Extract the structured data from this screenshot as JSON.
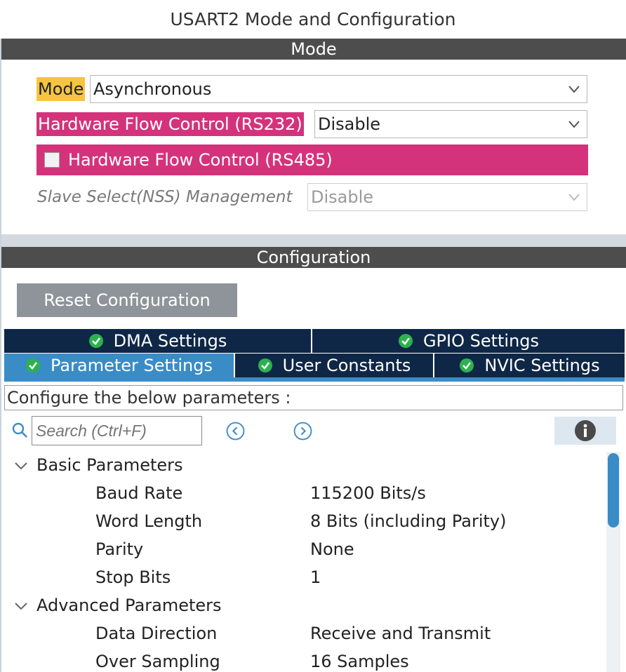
{
  "window": {
    "title": "USART2 Mode and Configuration"
  },
  "mode_section": {
    "header": "Mode",
    "mode": {
      "label": "Mode",
      "value": "Asynchronous"
    },
    "hw_flow_rs232": {
      "label": "Hardware Flow Control (RS232)",
      "value": "Disable"
    },
    "hw_flow_rs485": {
      "label": "Hardware Flow Control (RS485)",
      "checked": false
    },
    "slave_select": {
      "label": "Slave Select(NSS) Management",
      "value": "Disable",
      "disabled": true
    }
  },
  "config_section": {
    "header": "Configuration",
    "reset_label": "Reset Configuration",
    "tabs_row1": [
      {
        "label": "DMA Settings",
        "icon": "check-circle-icon",
        "active": false
      },
      {
        "label": "GPIO Settings",
        "icon": "check-circle-icon",
        "active": false
      }
    ],
    "tabs_row2": [
      {
        "label": "Parameter Settings",
        "icon": "check-circle-icon",
        "active": true
      },
      {
        "label": "User Constants",
        "icon": "check-circle-icon",
        "active": false
      },
      {
        "label": "NVIC Settings",
        "icon": "check-circle-icon",
        "active": false
      }
    ],
    "instructions": "Configure the below parameters :",
    "search_placeholder": "Search (Ctrl+F)",
    "groups": [
      {
        "name": "Basic Parameters",
        "params": [
          {
            "name": "Baud Rate",
            "value": "115200 Bits/s"
          },
          {
            "name": "Word Length",
            "value": "8 Bits (including Parity)"
          },
          {
            "name": "Parity",
            "value": "None"
          },
          {
            "name": "Stop Bits",
            "value": "1"
          }
        ]
      },
      {
        "name": "Advanced Parameters",
        "params": [
          {
            "name": "Data Direction",
            "value": "Receive and Transmit"
          },
          {
            "name": "Over Sampling",
            "value": "16 Samples"
          }
        ]
      }
    ]
  },
  "colors": {
    "mode_highlight": "#f5c542",
    "pinned_pink": "#d4337b",
    "section_bar": "#4d4d4d",
    "tab_dark": "#0f2747",
    "tab_active": "#3a8cc6",
    "check_green": "#2bb24c"
  }
}
